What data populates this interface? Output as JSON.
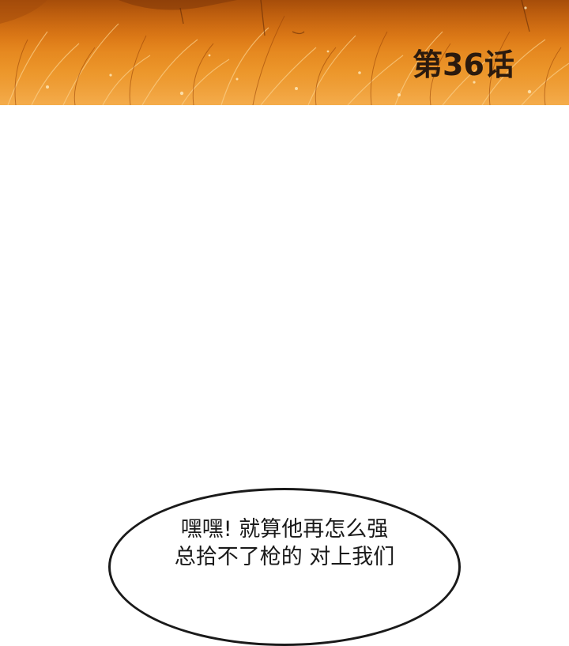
{
  "header": {
    "episode_title": "第36话"
  },
  "dialogue": {
    "bubble_line_1": "嘿嘿! 就算他再怎么强",
    "bubble_line_2": "总拾不了枪的 对上我们"
  },
  "colors": {
    "banner_dark": "#c9620e",
    "banner_light": "#f3a844",
    "title_text": "#2b1a0e",
    "bubble_border": "#1a1a1a"
  }
}
